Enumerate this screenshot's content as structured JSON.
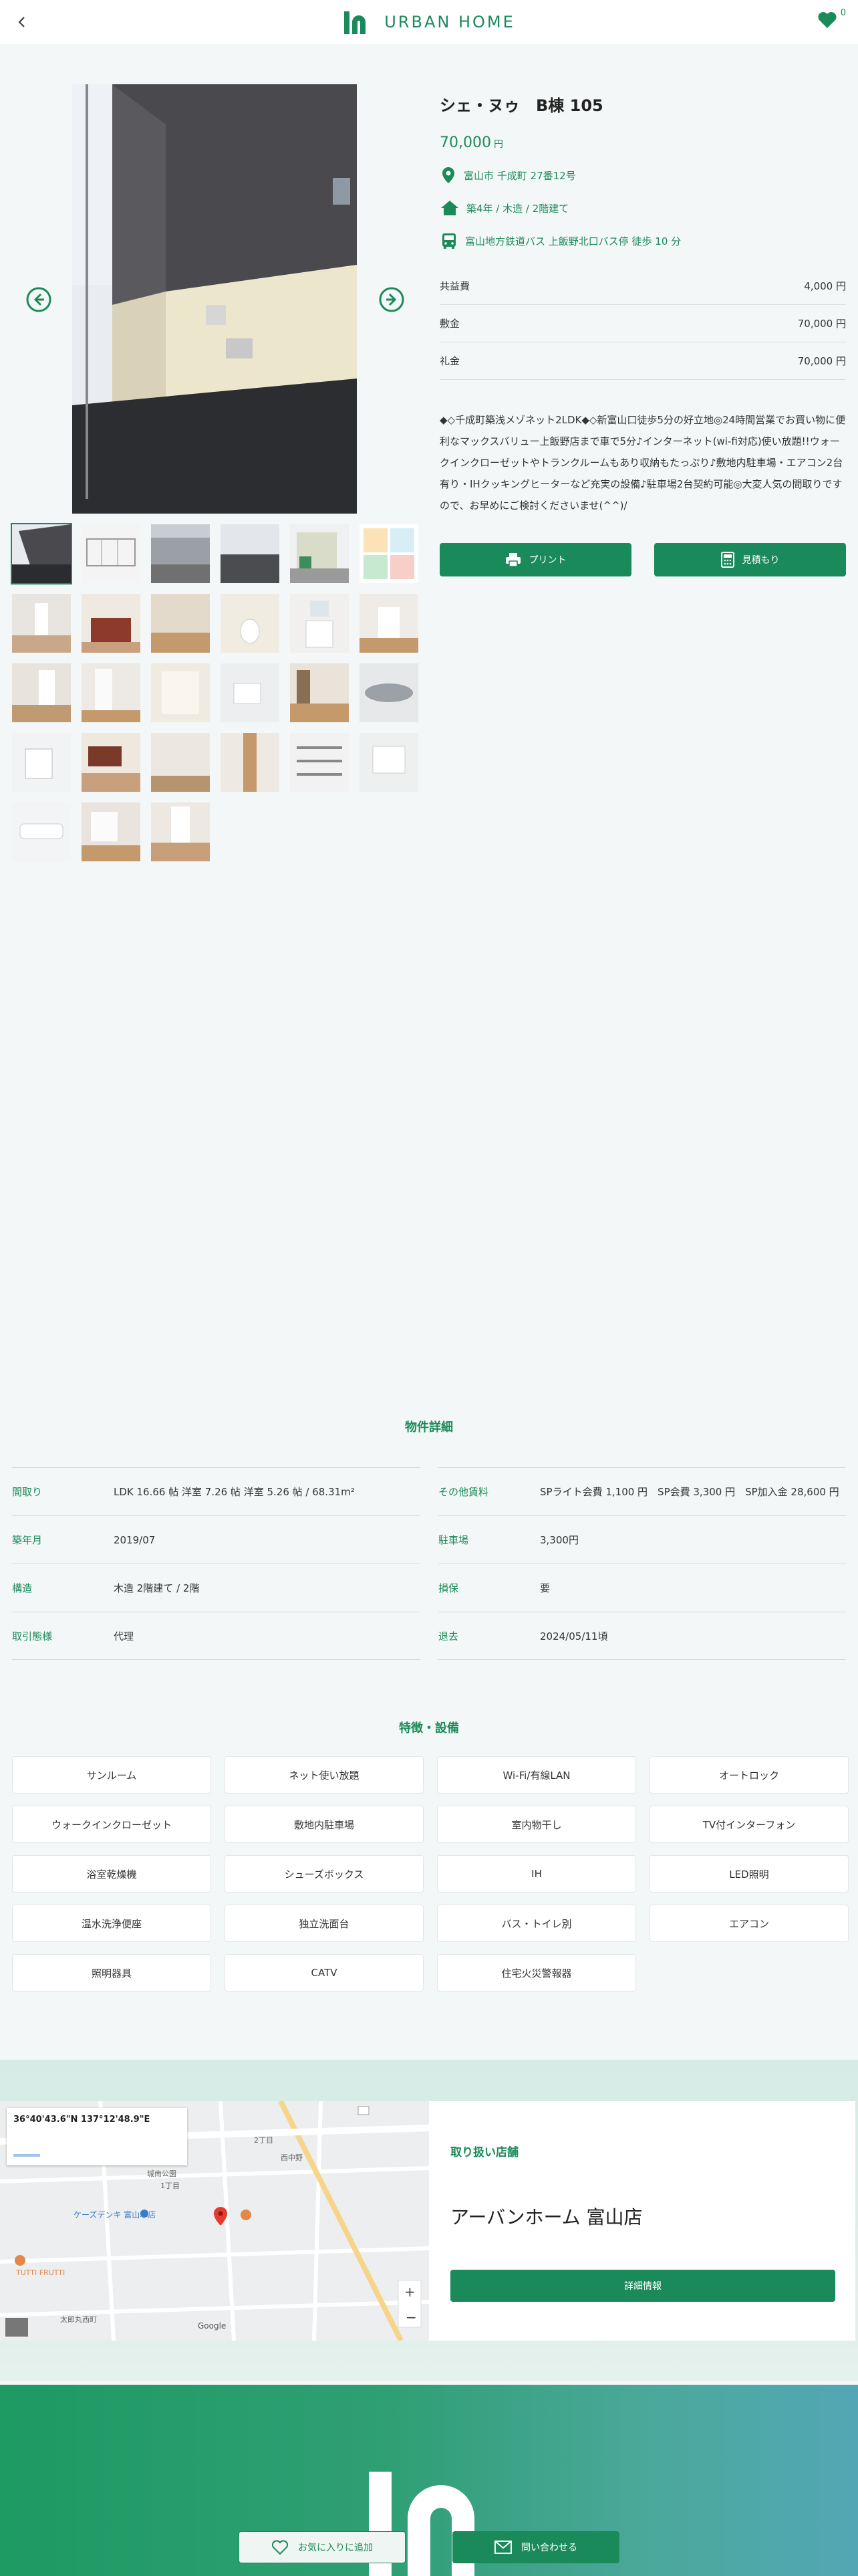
{
  "header": {
    "logo_text": "URBAN HOME",
    "favorite_count": "0"
  },
  "property": {
    "name": "シェ・ヌゥ　B棟 105",
    "price": "70,000",
    "price_unit": "円",
    "address": "富山市 千成町 27番12号",
    "age_structure": "築4年 / 木造 / 2階建て",
    "access": "富山地方鉄道バス 上飯野北口バス停 徒歩 10 分",
    "fees": [
      {
        "label": "共益費",
        "value": "4,000 円"
      },
      {
        "label": "敷金",
        "value": "70,000 円"
      },
      {
        "label": "礼金",
        "value": "70,000 円"
      }
    ],
    "description": "◆◇千成町築浅メゾネット2LDK◆◇新富山口徒歩5分の好立地◎24時間営業でお買い物に便利なマックスバリュー上飯野店まで車で5分♪インターネット(wi-fi対応)使い放題!!ウォークインクローゼットやトランクルームもあり収納もたっぷり♪敷地内駐車場・エアコン2台有り・IHクッキングヒーターなど充実の設備♪駐車場2台契約可能◎大変人気の間取りですので、お早めにご検討くださいませ(^^)/",
    "print_label": "プリント",
    "estimate_label": "見積もり"
  },
  "specs": {
    "title": "物件詳細",
    "left": [
      {
        "label": "間取り",
        "value": "LDK 16.66 帖 洋室 7.26 帖 洋室 5.26 帖 / 68.31m²"
      },
      {
        "label": "築年月",
        "value": "2019/07"
      },
      {
        "label": "構造",
        "value": "木造 2階建て / 2階"
      },
      {
        "label": "取引態様",
        "value": "代理"
      }
    ],
    "right": [
      {
        "label": "その他賃料",
        "value": "SPライト会費 1,100 円　SP会費 3,300 円　SP加入金 28,600 円"
      },
      {
        "label": "駐車場",
        "value": "3,300円"
      },
      {
        "label": "損保",
        "value": "要"
      },
      {
        "label": "退去",
        "value": "2024/05/11頃"
      }
    ]
  },
  "features": {
    "title": "特徴・設備",
    "items": [
      "サンルーム",
      "ネット使い放題",
      "Wi-Fi/有線LAN",
      "オートロック",
      "ウォークインクローゼット",
      "敷地内駐車場",
      "室内物干し",
      "TV付インターフォン",
      "浴室乾燥機",
      "シューズボックス",
      "IH",
      "LED照明",
      "温水洗浄便座",
      "独立洗面台",
      "バス・トイレ別",
      "エアコン",
      "照明器具",
      "CATV",
      "住宅火災警報器"
    ]
  },
  "map": {
    "coords": "36°40'43.6\"N 137°12'48.9\"E",
    "labels": [
      "2丁目",
      "西中野",
      "城南公園",
      "ケーズデンキ 富山本店",
      "1丁目",
      "太郎丸西町",
      "TUTTI FRUTTI",
      "Google"
    ]
  },
  "shop": {
    "label": "取り扱い店舗",
    "name": "アーバンホーム 富山店",
    "detail_label": "詳細情報"
  },
  "bottom": {
    "favorite_label": "お気に入りに追加",
    "contact_label": "問い合わせる"
  },
  "colors": {
    "accent": "#1b8a5a",
    "background": "#f4f7f7"
  }
}
